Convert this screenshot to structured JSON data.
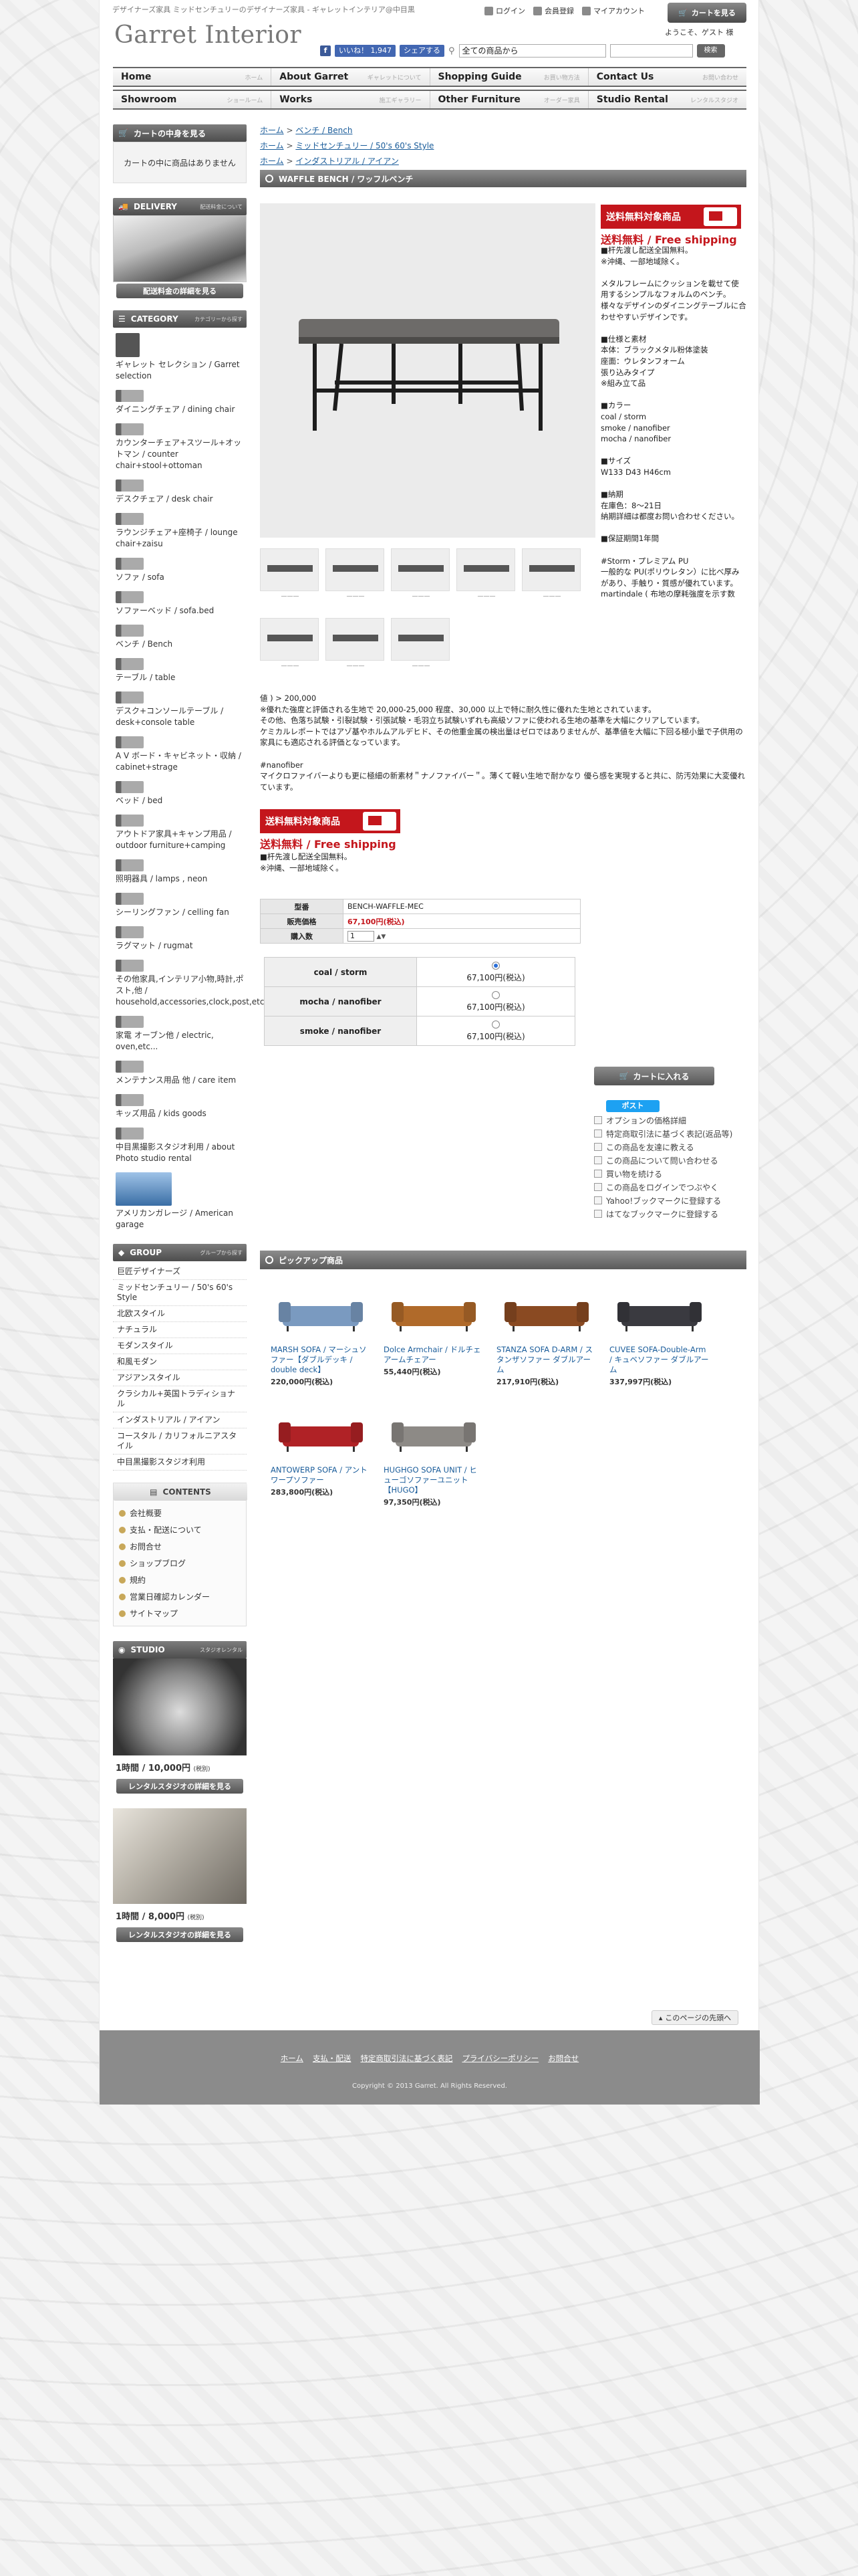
{
  "header": {
    "tagline": "デザイナーズ家具 ミッドセンチュリーのデザイナーズ家具 - ギャレットインテリア@中目黒",
    "logo": "Garret Interior",
    "top_links": [
      "ログイン",
      "会員登録",
      "マイアカウント"
    ],
    "cart_button": "カートを見る",
    "welcome": "ようこそ、ゲスト 様",
    "fb_like": "いいね！ 1,947",
    "fb_share": "シェアする",
    "search_select": "全ての商品から",
    "search_button": "検索"
  },
  "nav": {
    "row1": [
      {
        "label": "Home",
        "sub": "ホーム"
      },
      {
        "label": "About Garret",
        "sub": "ギャレットについて"
      },
      {
        "label": "Shopping Guide",
        "sub": "お買い物方法"
      },
      {
        "label": "Contact Us",
        "sub": "お問い合わせ"
      }
    ],
    "row2": [
      {
        "label": "Showroom",
        "sub": "ショールーム"
      },
      {
        "label": "Works",
        "sub": "施工ギャラリー"
      },
      {
        "label": "Other Furniture",
        "sub": "オーダー家具"
      },
      {
        "label": "Studio Rental",
        "sub": "レンタルスタジオ"
      }
    ]
  },
  "sidebar": {
    "cart_header": "カートの中身を見る",
    "cart_empty": "カートの中に商品はありません",
    "delivery_header": "DELIVERY",
    "delivery_sub": "配送料金について",
    "delivery_button": "配送料金の詳細を見る",
    "category_header": "CATEGORY",
    "category_sub": "カテゴリーから探す",
    "categories": [
      "ギャレット セレクション / Garret selection",
      "ダイニングチェア / dining chair",
      "カウンターチェア+スツール+オットマン / counter chair+stool+ottoman",
      "デスクチェア / desk chair",
      "ラウンジチェア+座椅子 / lounge chair+zaisu",
      "ソファ / sofa",
      "ソファーベッド / sofa.bed",
      "ベンチ / Bench",
      "テーブル / table",
      "デスク+コンソールテーブル / desk+console table",
      "A V ボード・キャビネット・収納 / cabinet+strage",
      "ベッド / bed",
      "アウトドア家具+キャンプ用品 / outdoor furniture+camping",
      "照明器具 / lamps , neon",
      "シーリングファン / celling fan",
      "ラグマット / rugmat",
      "その他家具,インテリア小物,時計,ポスト,他 / household,accessories,clock,post,etc...",
      "家電 オーブン他 / electric, oven,etc...",
      "メンテナンス用品 他 / care item",
      "キッズ用品 / kids goods",
      "中目黒撮影スタジオ利用 / about Photo studio rental",
      "アメリカンガレージ / American garage"
    ],
    "american_garage_logo": "American Garage",
    "group_header": "GROUP",
    "group_sub": "グループから探す",
    "groups": [
      "巨匠デザイナーズ",
      "ミッドセンチュリー / 50's 60's Style",
      "北欧スタイル",
      "ナチュラル",
      "モダンスタイル",
      "和風モダン",
      "アジアンスタイル",
      "クラシカル+英国トラディショナル",
      "インダストリアル / アイアン",
      "コースタル / カリフォルニアスタイル",
      "中目黒撮影スタジオ利用"
    ],
    "contents_header": "CONTENTS",
    "contents": [
      "会社概要",
      "支払・配送について",
      "お問合せ",
      "ショップブログ",
      "規約",
      "営業日確認カレンダー",
      "サイトマップ"
    ],
    "studio_header": "STUDIO",
    "studio_sub": "スタジオレンタル",
    "studio1_price": "1時間 / 10,000円",
    "studio1_tax": "(税別)",
    "studio2_price": "1時間 / 8,000円",
    "studio2_tax": "(税別)",
    "studio_button": "レンタルスタジオの詳細を見る"
  },
  "breadcrumbs": [
    [
      "ホーム",
      "ベンチ / Bench"
    ],
    [
      "ホーム",
      "ミッドセンチュリー / 50's 60's Style"
    ],
    [
      "ホーム",
      "インダストリアル / アイアン"
    ]
  ],
  "product": {
    "title": "WAFFLE BENCH / ワッフルベンチ",
    "badge_label": "送料無料対象商品",
    "free_shipping": "送料無料 / Free shipping",
    "description_right": [
      "■杆先渡し配送全国無料。",
      "※沖縄、一部地域除く。",
      "",
      "メタルフレームにクッションを載せて使用するシンプルなフォルムのベンチ。",
      "様々なデザインのダイニングテーブルに合わせやすいデザインです。",
      "",
      "■仕様と素材",
      "本体：ブラックメタル粉体塗装",
      "座面：ウレタンフォーム",
      "張り込みタイプ",
      "※組み立て品",
      "",
      "■カラー",
      "coal / storm",
      "smoke / nanofiber",
      "mocha / nanofiber",
      "",
      "■サイズ",
      "W133 D43 H46cm",
      "",
      "■納期",
      "在庫色：8〜21日",
      "納期詳細は都度お問い合わせください。",
      "",
      "■保証期間1年間",
      "",
      "#Storm・プレミアム PU",
      "一般的な PU(ポリウレタン）に比べ厚みがあり、手触り・質感が優れています。",
      "martindale ( 布地の摩耗強度を示す数"
    ],
    "description_full": [
      "値 ) > 200,000",
      "※優れた強度と評価される生地で 20,000-25,000 程度、30,000 以上で特に耐久性に優れた生地とされています。",
      "その他、色落ち試験・引裂試験・引張試験・毛羽立ち試験いずれも高級ソファに使われる生地の基準を大幅にクリアしています。",
      "ケミカルレポートではアゾ基やホルムアルデヒド、その他重金属の検出量はゼロではありませんが、基準値を大幅に下回る極小量で子供用の家具にも適応される評価となっています。",
      "",
      "#nanofiber",
      "マイクロファイバーよりも更に極細の新素材＂ナノファイバー＂。薄くて軽い生地で耐かなり 優ら感を実現すると共に、防汚効果に大変優れています。"
    ],
    "free_shipping_note": [
      "■杆先渡し配送全国無料。",
      "※沖縄、一部地域除く。"
    ],
    "thumb_captions": [
      "———",
      "———",
      "———",
      "———",
      "———",
      "———",
      "———",
      "———"
    ],
    "spec": {
      "model_label": "型番",
      "model": "BENCH-WAFFLE-MEC",
      "price_label": "販売価格",
      "price": "67,100円(税込)",
      "qty_label": "購入数",
      "qty": "1"
    },
    "options": [
      {
        "name": "coal / storm",
        "price": "67,100円(税込)",
        "selected": true
      },
      {
        "name": "mocha / nanofiber",
        "price": "67,100円(税込)",
        "selected": false
      },
      {
        "name": "smoke / nanofiber",
        "price": "67,100円(税込)",
        "selected": false
      }
    ],
    "add_to_cart": "カートに入れる",
    "tweet": "ポスト",
    "links": [
      "オプションの価格詳細",
      "特定商取引法に基づく表記(返品等)",
      "この商品を友達に教える",
      "この商品について問い合わせる",
      "買い物を続ける",
      "この商品をログインでつぶやく",
      "Yahoo!ブックマークに登録する",
      "はてなブックマークに登録する"
    ]
  },
  "pickup": {
    "header": "ピックアップ商品",
    "items": [
      {
        "name": "MARSH SOFA / マーシュソファー【ダブルデッキ / double deck】",
        "price": "220,000円(税込)",
        "color": "#7a9ac0"
      },
      {
        "name": "Dolce Armchair / ドルチェアームチェアー",
        "price": "55,440円(税込)",
        "color": "#b06a2a"
      },
      {
        "name": "STANZA SOFA D-ARM / スタンザソファー ダブルアーム",
        "price": "217,910円(税込)",
        "color": "#8a4a22"
      },
      {
        "name": "CUVEE SOFA-Double-Arm / キュベソファー ダブルアーム",
        "price": "337,997円(税込)",
        "color": "#3a3a40"
      },
      {
        "name": "ANTOWERP SOFA / アントワープソファー",
        "price": "283,800円(税込)",
        "color": "#b02226"
      },
      {
        "name": "HUGHGO SOFA UNIT / ヒューゴソファーユニット【HUGO】",
        "price": "97,350円(税込)",
        "color": "#8d8a86"
      }
    ]
  },
  "back_button": "このページの先頭へ",
  "footer": {
    "links": [
      "ホーム",
      "支払・配送",
      "特定商取引法に基づく表記",
      "プライバシーポリシー",
      "お問合せ"
    ],
    "copyright": "Copyright © 2013 Garret. All Rights Reserved."
  }
}
